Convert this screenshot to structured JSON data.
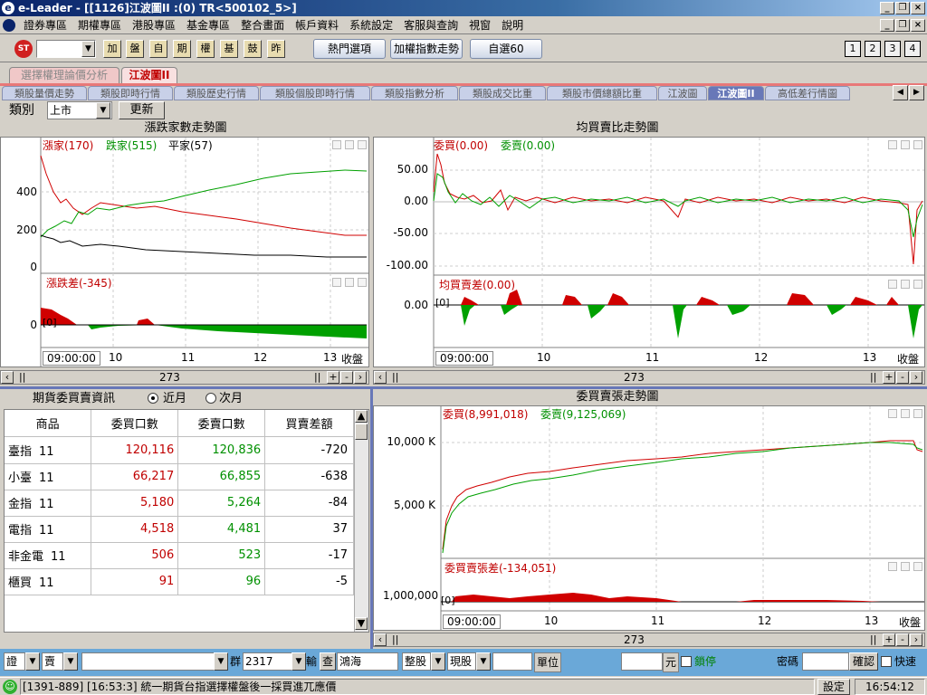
{
  "window": {
    "title": "e-Leader - [[1126]江波圖II :(0) TR<500102_5>]"
  },
  "menu": [
    "證券專區",
    "期權專區",
    "港股專區",
    "基金專區",
    "整合畫面",
    "帳戶資料",
    "系統設定",
    "客服與查詢",
    "視窗",
    "說明"
  ],
  "toolbar": {
    "icons": [
      "加",
      "盤",
      "自",
      "期",
      "權",
      "基",
      "鼓",
      "昨"
    ],
    "buttons": [
      "熱門選項",
      "加權指數走勢",
      "自選60"
    ],
    "numbers": [
      "1",
      "2",
      "3",
      "4"
    ]
  },
  "tabs_top": [
    "選擇權理論價分析",
    "江波圖II"
  ],
  "tabs_sub": [
    "類股量價走勢",
    "類股即時行情",
    "類股歷史行情",
    "類股個股即時行情",
    "類股指數分析",
    "類股成交比重",
    "類股市價總額比重",
    "江波圖",
    "江波圖II",
    "高低差行情圖"
  ],
  "filter": {
    "label": "類別",
    "value": "上市",
    "refresh": "更新"
  },
  "panel_adv": {
    "title": "漲跌家數走勢圖",
    "legend": {
      "up": "漲家(170)",
      "down": "跌家(515)",
      "flat": "平家(57)"
    },
    "y_ticks": [
      "400",
      "200",
      "0"
    ],
    "sub_legend": "漲跌差(-345)",
    "sub_y": "0",
    "sub_zero": "[0]",
    "x_start": "09:00:00",
    "x_ticks": [
      "10",
      "11",
      "12",
      "13"
    ],
    "x_end": "收盤",
    "scroll_value": "273"
  },
  "panel_avg": {
    "title": "均買賣比走勢圖",
    "legend": {
      "buy": "委買(0.00)",
      "sell": "委賣(0.00)"
    },
    "y_ticks": [
      "50.00",
      "0.00",
      "-50.00",
      "-100.00"
    ],
    "sub_legend": "均買賣差(0.00)",
    "sub_y": "0.00",
    "sub_zero": "[0]",
    "x_start": "09:00:00",
    "x_ticks": [
      "10",
      "11",
      "12",
      "13"
    ],
    "x_end": "收盤",
    "scroll_value": "273"
  },
  "futures": {
    "title": "期貨委買賣資訊",
    "radio": [
      "近月",
      "次月"
    ],
    "headers": [
      "商品",
      "委買口數",
      "委賣口數",
      "買賣差額"
    ],
    "rows": [
      {
        "name": "臺指",
        "m": "11",
        "buy": "120,116",
        "sell": "120,836",
        "diff": "-720"
      },
      {
        "name": "小臺",
        "m": "11",
        "buy": "66,217",
        "sell": "66,855",
        "diff": "-638"
      },
      {
        "name": "金指",
        "m": "11",
        "buy": "5,180",
        "sell": "5,264",
        "diff": "-84"
      },
      {
        "name": "電指",
        "m": "11",
        "buy": "4,518",
        "sell": "4,481",
        "diff": "37"
      },
      {
        "name": "非金電",
        "m": "11",
        "buy": "506",
        "sell": "523",
        "diff": "-17"
      },
      {
        "name": "櫃買",
        "m": "11",
        "buy": "91",
        "sell": "96",
        "diff": "-5"
      }
    ]
  },
  "panel_lots": {
    "title": "委買賣張走勢圖",
    "legend": {
      "buy": "委買(8,991,018)",
      "sell": "委賣(9,125,069)"
    },
    "y_ticks": [
      "10,000 K",
      "5,000 K"
    ],
    "sub_legend": "委買賣張差(-134,051)",
    "sub_y": "1,000,000",
    "sub_zero": "[0]",
    "x_start": "09:00:00",
    "x_ticks": [
      "10",
      "11",
      "12",
      "13"
    ],
    "x_end": "收盤",
    "scroll_value": "273"
  },
  "order_bar": {
    "type": "證",
    "side": "賣",
    "group_label": "群",
    "code": "2317",
    "input_label": "輸",
    "query": "查",
    "name": "鴻海",
    "lot": "整股",
    "price_type": "現股",
    "unit": "單位",
    "currency": "元",
    "lock": "鎖停",
    "pwd": "密碼",
    "confirm": "確認",
    "fast": "快速"
  },
  "status": {
    "message": "[1391-889] [16:53:3] 統一期貨台指選擇權盤後一採買進兀應價",
    "settings": "設定",
    "time": "16:54:12"
  },
  "colors": {
    "up": "#c00000",
    "down": "#009000",
    "accent": "#0a246a"
  }
}
